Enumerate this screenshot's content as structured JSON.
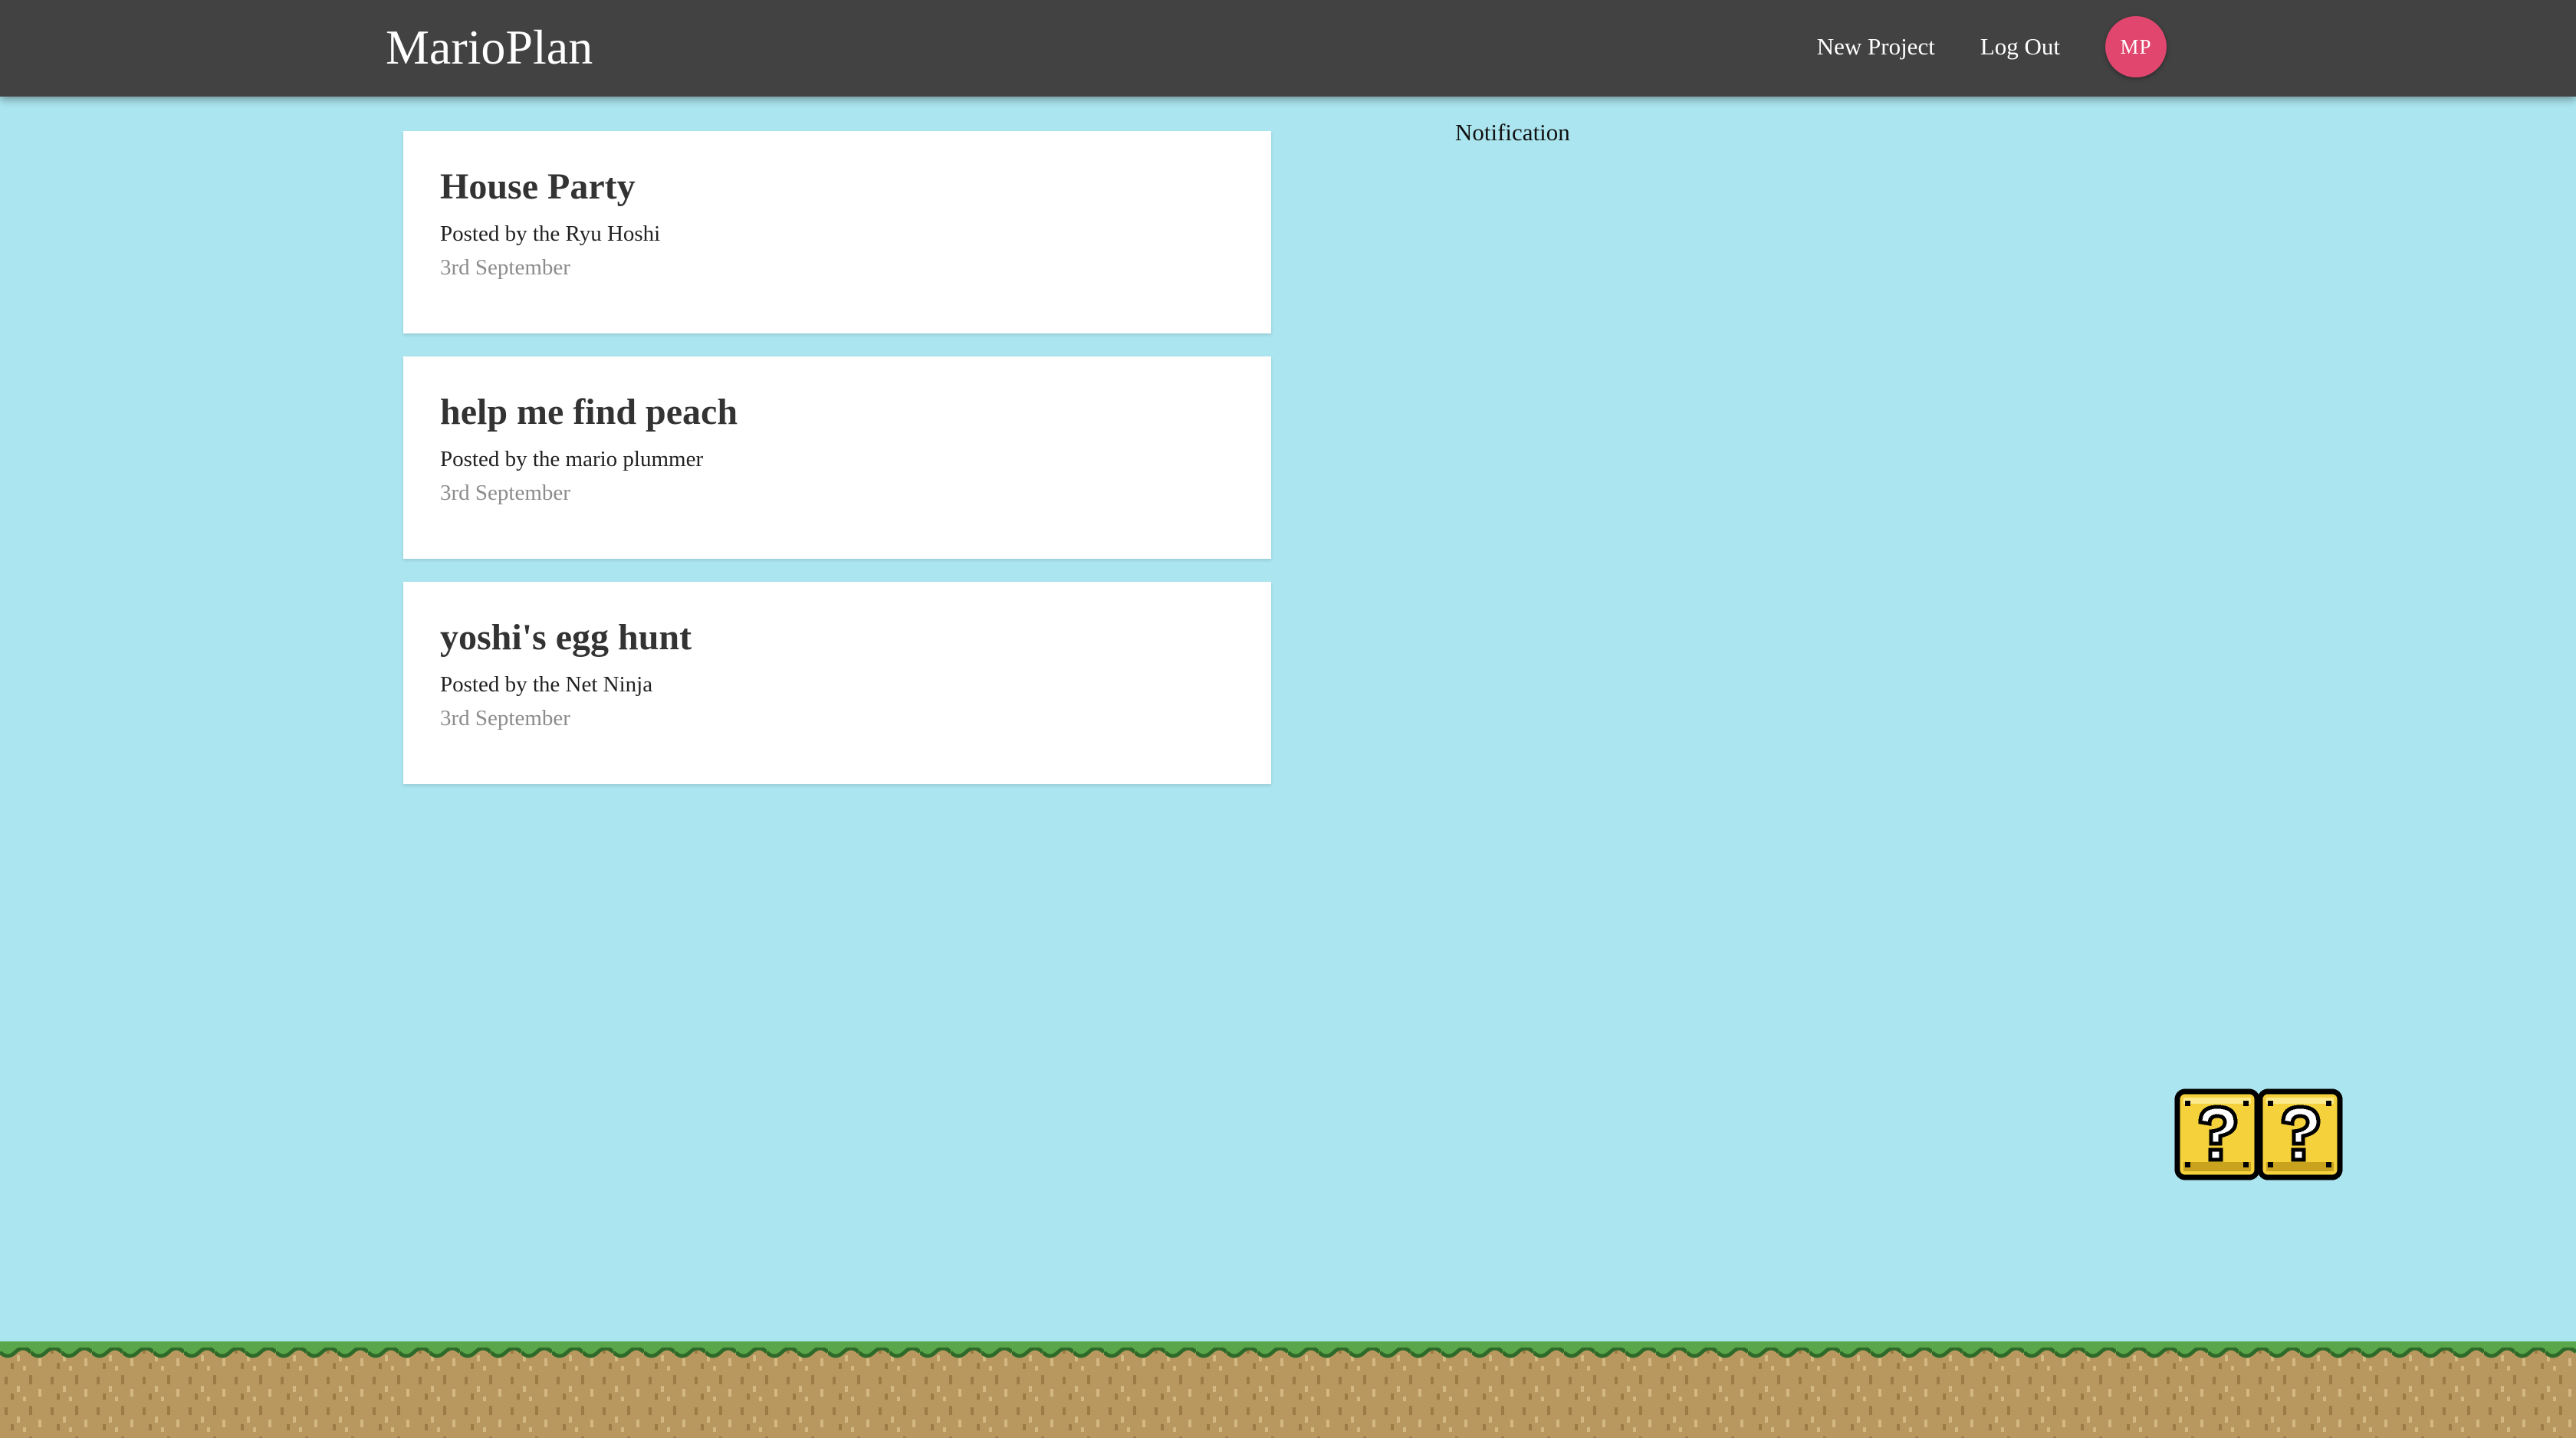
{
  "navbar": {
    "brand": "MarioPlan",
    "links": [
      {
        "label": "New Project"
      },
      {
        "label": "Log Out"
      }
    ],
    "avatar_initials": "MP"
  },
  "projects": [
    {
      "title": "House Party",
      "author": "Posted by the Ryu Hoshi",
      "date": "3rd September"
    },
    {
      "title": "help me find peach",
      "author": "Posted by the mario plummer",
      "date": "3rd September"
    },
    {
      "title": "yoshi's egg hunt",
      "author": "Posted by the Net Ninja",
      "date": "3rd September"
    }
  ],
  "notifications": {
    "title": "Notification"
  },
  "colors": {
    "background": "#abe5ef",
    "navbar": "#424242",
    "avatar": "#e0466e",
    "card": "#ffffff",
    "grass": "#5aa64a",
    "dirt": "#b8985f",
    "block": "#f5d23c"
  },
  "icons": {
    "decor_blocks": "question-block-icon",
    "ground": "grass-ground"
  }
}
